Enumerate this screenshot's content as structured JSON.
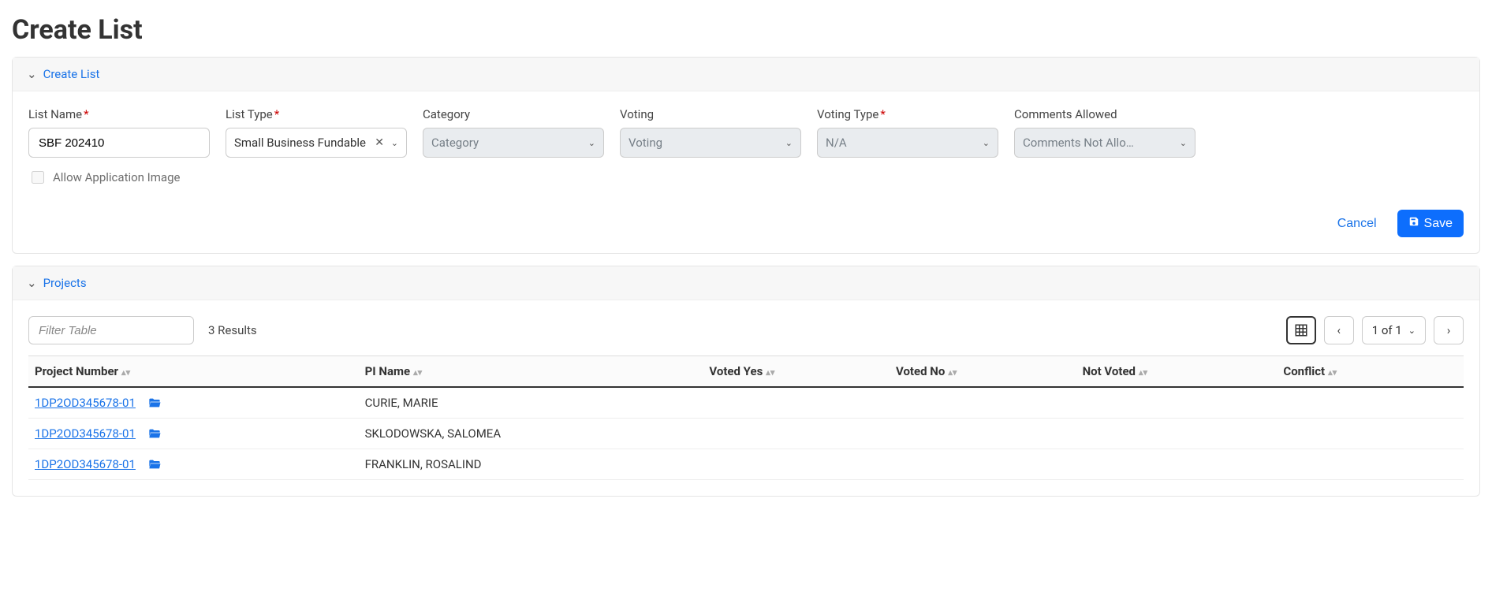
{
  "page_title": "Create List",
  "panels": {
    "create_list": {
      "title": "Create List"
    },
    "projects": {
      "title": "Projects"
    }
  },
  "form": {
    "list_name": {
      "label": "List Name",
      "value": "SBF 202410"
    },
    "list_type": {
      "label": "List Type",
      "value": "Small Business Fundable"
    },
    "category": {
      "label": "Category",
      "placeholder": "Category"
    },
    "voting": {
      "label": "Voting",
      "placeholder": "Voting"
    },
    "voting_type": {
      "label": "Voting Type",
      "value": "N/A"
    },
    "comments": {
      "label": "Comments Allowed",
      "value": "Comments Not Allo…"
    },
    "allow_image": {
      "label": "Allow Application Image",
      "checked": false
    }
  },
  "actions": {
    "cancel": "Cancel",
    "save": "Save"
  },
  "projects": {
    "filter_placeholder": "Filter Table",
    "results_text": "3 Results",
    "pagination": "1 of 1",
    "columns": {
      "project_number": "Project Number",
      "pi_name": "PI Name",
      "voted_yes": "Voted Yes",
      "voted_no": "Voted No",
      "not_voted": "Not Voted",
      "conflict": "Conflict"
    },
    "rows": [
      {
        "project_number": "1DP2OD345678-01",
        "pi_name": "CURIE, MARIE",
        "voted_yes": "",
        "voted_no": "",
        "not_voted": "",
        "conflict": ""
      },
      {
        "project_number": "1DP2OD345678-01",
        "pi_name": "SKLODOWSKA, SALOMEA",
        "voted_yes": "",
        "voted_no": "",
        "not_voted": "",
        "conflict": ""
      },
      {
        "project_number": "1DP2OD345678-01",
        "pi_name": "FRANKLIN, ROSALIND",
        "voted_yes": "",
        "voted_no": "",
        "not_voted": "",
        "conflict": ""
      }
    ]
  }
}
